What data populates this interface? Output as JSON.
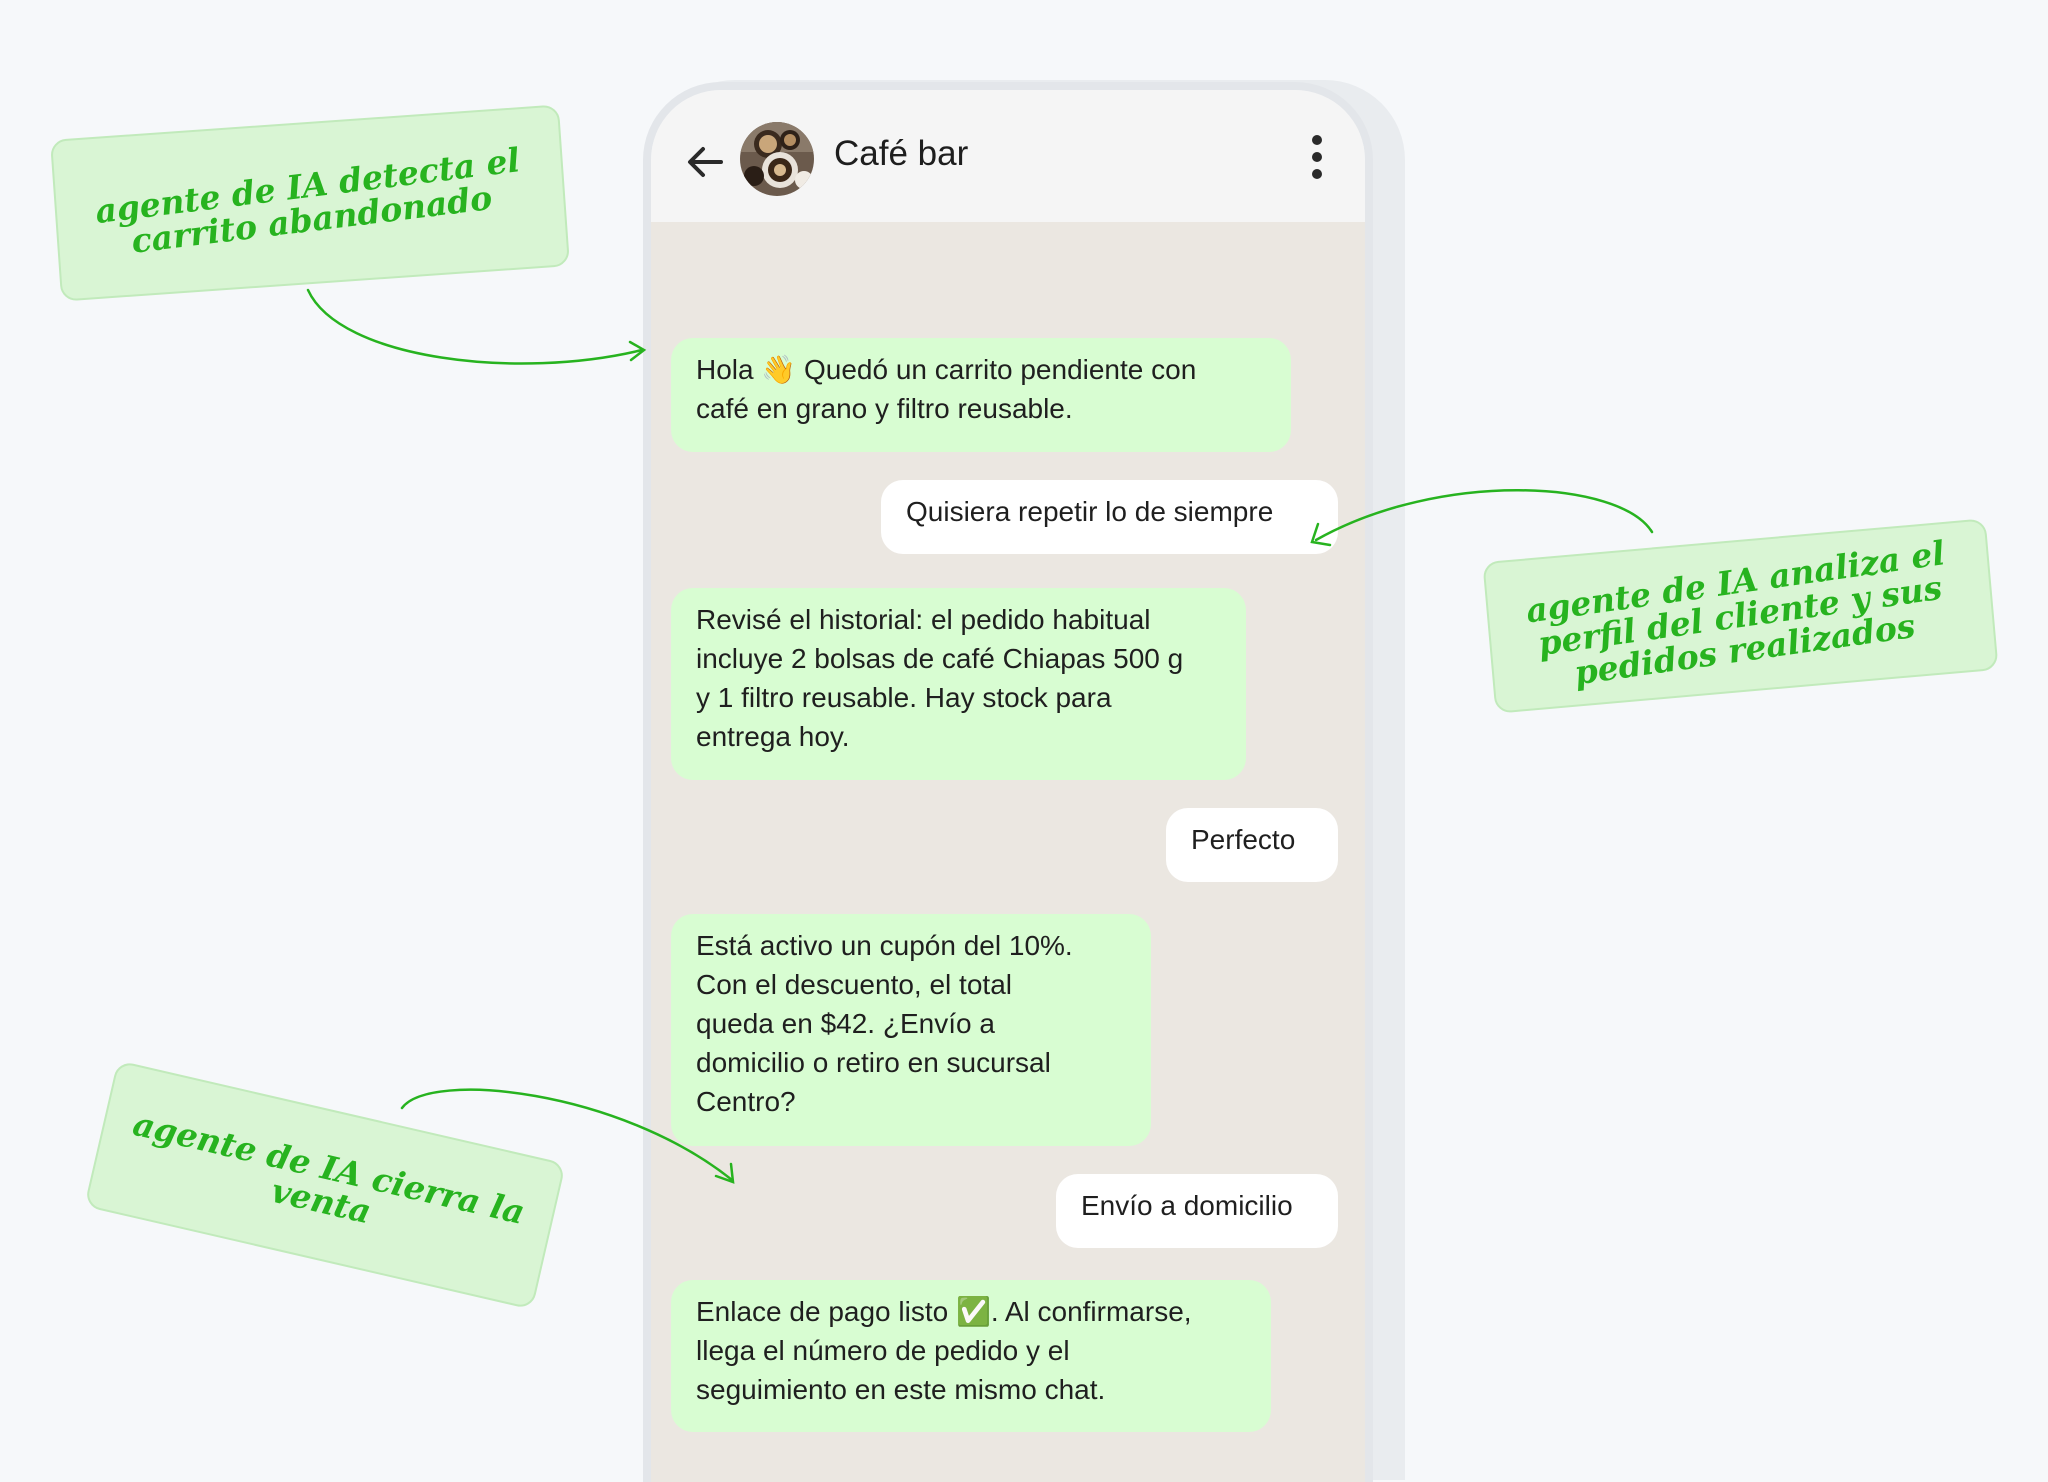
{
  "chat": {
    "title": "Café bar",
    "messages": [
      {
        "direction": "in",
        "text": "Hola 👋 Quedó un carrito pendiente con\ncafé en grano y filtro reusable."
      },
      {
        "direction": "out",
        "text": "Quisiera repetir lo de siempre"
      },
      {
        "direction": "in",
        "text": "Revisé el historial: el pedido habitual\nincluye 2 bolsas de café Chiapas 500 g\ny 1 filtro reusable. Hay stock para\nentrega hoy."
      },
      {
        "direction": "out",
        "text": "Perfecto"
      },
      {
        "direction": "in",
        "text": "Está activo un cupón del 10%.\nCon el descuento, el total\nqueda en $42. ¿Envío a\ndomicilio o retiro en sucursal\nCentro?"
      },
      {
        "direction": "out",
        "text": "Envío a domicilio"
      },
      {
        "direction": "in",
        "text": "Enlace de pago listo ✅. Al confirmarse,\nllega el número de pedido y el\nseguimiento en este mismo chat."
      }
    ]
  },
  "annotations": {
    "cart": "agente de IA detecta el\ncarrito abandonado",
    "profile": "agente de IA analiza el\nperfil del cliente y sus\npedidos realizados",
    "sale": "agente de IA cierra la\nventa"
  },
  "icons": {
    "back": "arrow-left-icon",
    "menu": "more-vertical-icon",
    "avatar": "coffee-cups-avatar"
  },
  "colors": {
    "incoming_bubble": "#d8fdd2",
    "outgoing_bubble": "#ffffff",
    "chat_background": "#ebe7e1",
    "annotation_text": "#27b31f",
    "annotation_bg": "#d9f5d4"
  }
}
